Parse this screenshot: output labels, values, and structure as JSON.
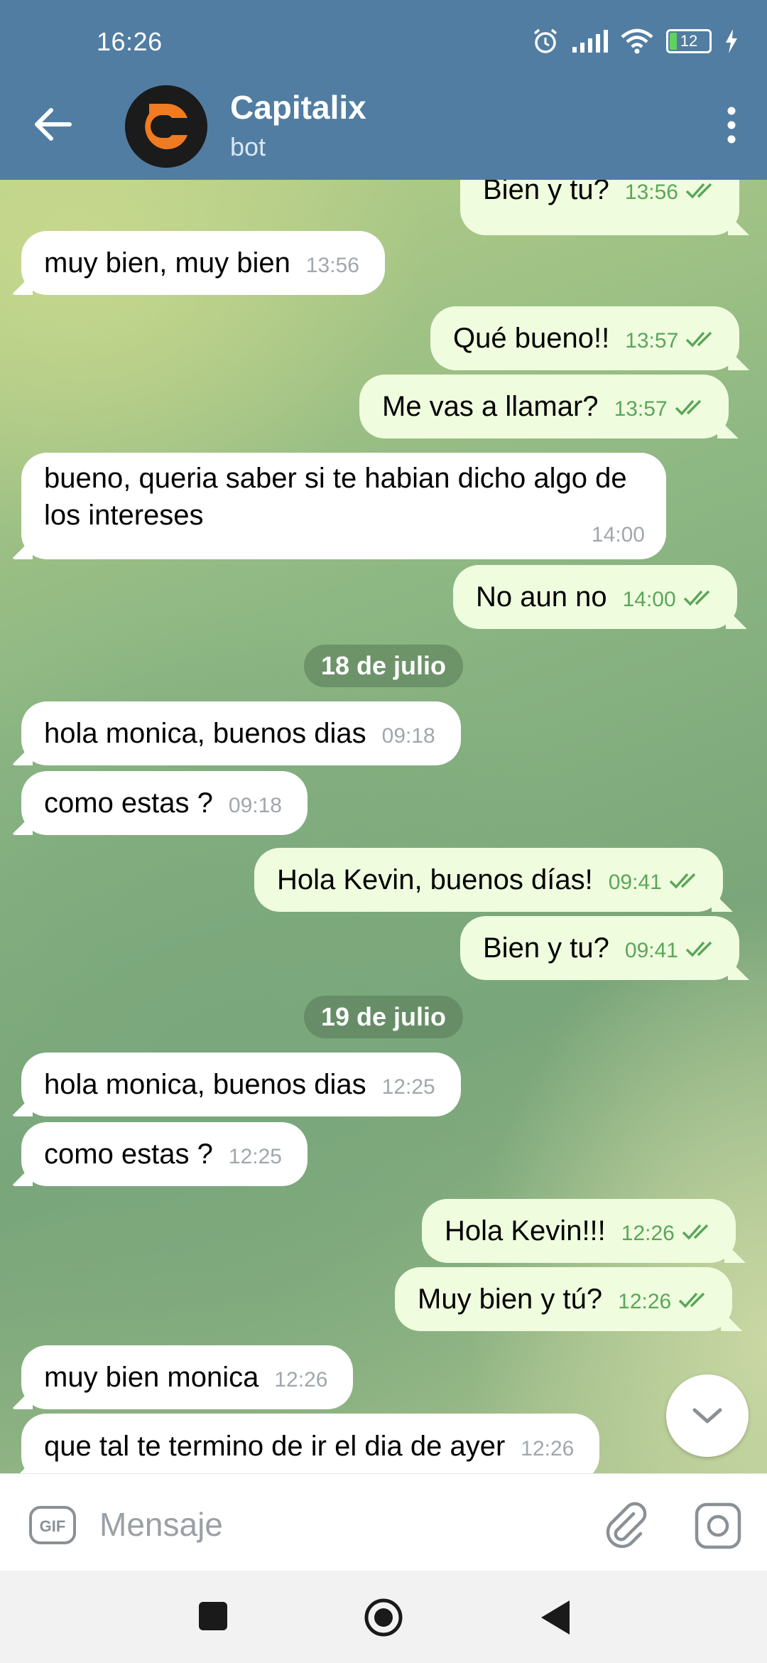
{
  "status_bar": {
    "time": "16:26",
    "battery": "12"
  },
  "header": {
    "title": "Capitalix",
    "subtitle": "bot"
  },
  "messages": [
    {
      "dir": "out",
      "text": "Bien y tu?",
      "time": "13:56"
    },
    {
      "dir": "in",
      "text": "muy bien, muy bien",
      "time": "13:56"
    },
    {
      "dir": "out",
      "text": "Qué bueno!!",
      "time": "13:57"
    },
    {
      "dir": "out",
      "text": "Me vas a llamar?",
      "time": "13:57"
    },
    {
      "dir": "in",
      "text": "bueno, queria saber si te habian dicho algo de los intereses",
      "time": "14:00"
    },
    {
      "dir": "out",
      "text": "No aun no",
      "time": "14:00"
    },
    {
      "dir": "in",
      "text": "hola monica, buenos dias",
      "time": "09:18"
    },
    {
      "dir": "in",
      "text": "como estas ?",
      "time": "09:18"
    },
    {
      "dir": "out",
      "text": "Hola Kevin, buenos días!",
      "time": "09:41"
    },
    {
      "dir": "out",
      "text": "Bien y tu?",
      "time": "09:41"
    },
    {
      "dir": "in",
      "text": "hola monica, buenos dias",
      "time": "12:25"
    },
    {
      "dir": "in",
      "text": "como estas ?",
      "time": "12:25"
    },
    {
      "dir": "out",
      "text": "Hola Kevin!!!",
      "time": "12:26"
    },
    {
      "dir": "out",
      "text": "Muy bien y tú?",
      "time": "12:26"
    },
    {
      "dir": "in",
      "text": "muy bien monica",
      "time": "12:26"
    },
    {
      "dir": "in",
      "text": "que tal te termino de ir el dia de ayer",
      "time": "12:26"
    }
  ],
  "dates": [
    "18 de julio",
    "19 de julio"
  ],
  "composer": {
    "placeholder": "Mensaje"
  }
}
